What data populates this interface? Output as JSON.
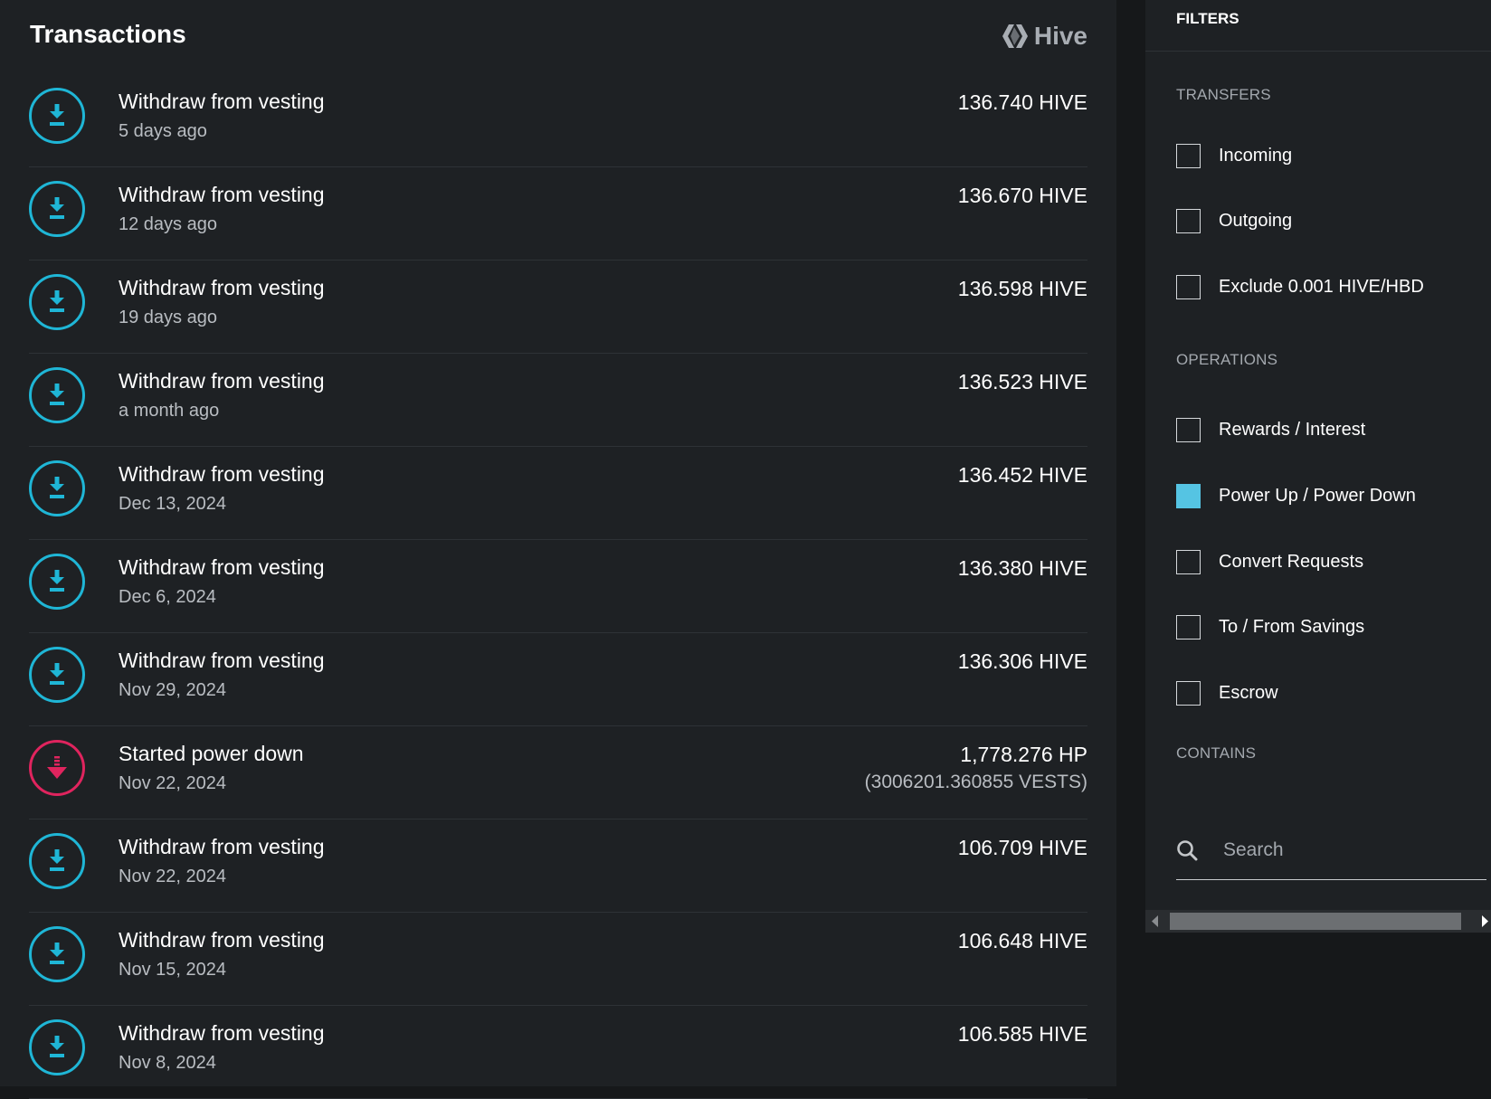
{
  "header": {
    "title": "Transactions",
    "brand": "Hive"
  },
  "colors": {
    "accent": "#1fb6d6",
    "danger": "#e0245e",
    "checked": "#55c4e3"
  },
  "transactions": [
    {
      "label": "Withdraw from vesting",
      "date": "5 days ago",
      "amount": "136.740 HIVE",
      "icon": "download-icon"
    },
    {
      "label": "Withdraw from vesting",
      "date": "12 days ago",
      "amount": "136.670 HIVE",
      "icon": "download-icon"
    },
    {
      "label": "Withdraw from vesting",
      "date": "19 days ago",
      "amount": "136.598 HIVE",
      "icon": "download-icon"
    },
    {
      "label": "Withdraw from vesting",
      "date": "a month ago",
      "amount": "136.523 HIVE",
      "icon": "download-icon"
    },
    {
      "label": "Withdraw from vesting",
      "date": "Dec 13, 2024",
      "amount": "136.452 HIVE",
      "icon": "download-icon"
    },
    {
      "label": "Withdraw from vesting",
      "date": "Dec 6, 2024",
      "amount": "136.380 HIVE",
      "icon": "download-icon"
    },
    {
      "label": "Withdraw from vesting",
      "date": "Nov 29, 2024",
      "amount": "136.306 HIVE",
      "icon": "download-icon"
    },
    {
      "label": "Started power down",
      "date": "Nov 22, 2024",
      "amount": "1,778.276 HP",
      "subamount": "(3006201.360855 VESTS)",
      "icon": "power-down-icon"
    },
    {
      "label": "Withdraw from vesting",
      "date": "Nov 22, 2024",
      "amount": "106.709 HIVE",
      "icon": "download-icon"
    },
    {
      "label": "Withdraw from vesting",
      "date": "Nov 15, 2024",
      "amount": "106.648 HIVE",
      "icon": "download-icon"
    },
    {
      "label": "Withdraw from vesting",
      "date": "Nov 8, 2024",
      "amount": "106.585 HIVE",
      "icon": "download-icon"
    }
  ],
  "filters": {
    "title": "FILTERS",
    "transfers": {
      "title": "TRANSFERS",
      "options": [
        {
          "label": "Incoming",
          "checked": false
        },
        {
          "label": "Outgoing",
          "checked": false
        },
        {
          "label": "Exclude 0.001 HIVE/HBD",
          "checked": false
        }
      ]
    },
    "operations": {
      "title": "OPERATIONS",
      "options": [
        {
          "label": "Rewards / Interest",
          "checked": false
        },
        {
          "label": "Power Up / Power Down",
          "checked": true
        },
        {
          "label": "Convert Requests",
          "checked": false
        },
        {
          "label": "To / From Savings",
          "checked": false
        },
        {
          "label": "Escrow",
          "checked": false
        }
      ]
    },
    "contains": {
      "title": "CONTAINS",
      "placeholder": "Search",
      "value": ""
    }
  }
}
